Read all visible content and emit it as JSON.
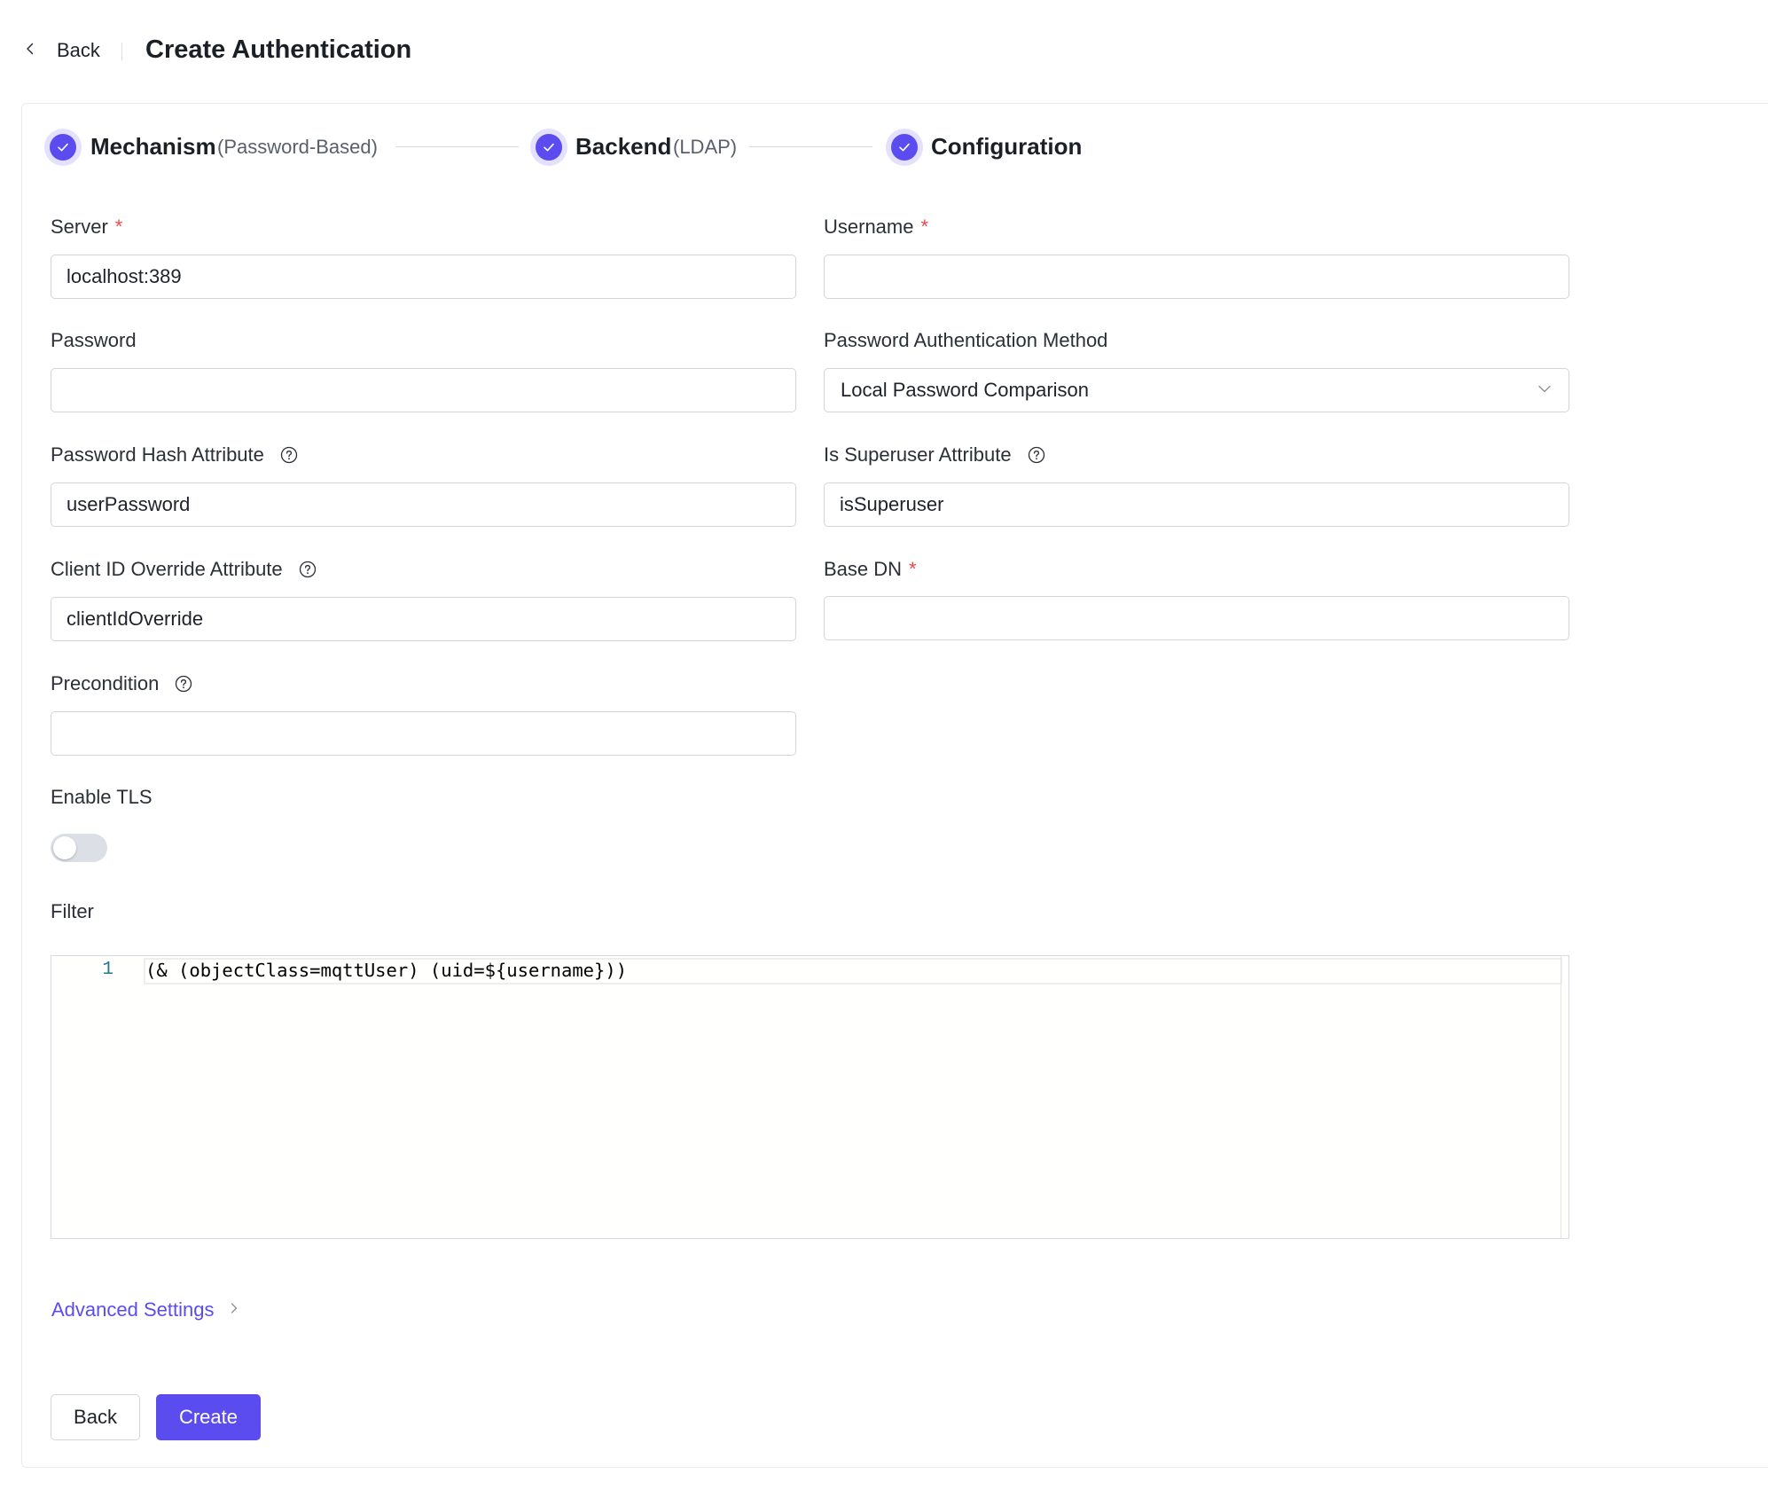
{
  "header": {
    "back_label": "Back",
    "title": "Create Authentication"
  },
  "steps": [
    {
      "title": "Mechanism",
      "subtitle": "(Password-Based)"
    },
    {
      "title": "Backend",
      "subtitle": "(LDAP)"
    },
    {
      "title": "Configuration",
      "subtitle": ""
    }
  ],
  "form": {
    "server": {
      "label": "Server",
      "required_mark": "*",
      "value": "localhost:389"
    },
    "username": {
      "label": "Username",
      "required_mark": "*",
      "value": ""
    },
    "password": {
      "label": "Password",
      "value": ""
    },
    "auth_method": {
      "label": "Password Authentication Method",
      "value": "Local Password Comparison"
    },
    "hash_attr": {
      "label": "Password Hash Attribute",
      "value": "userPassword"
    },
    "superuser_attr": {
      "label": "Is Superuser Attribute",
      "value": "isSuperuser"
    },
    "client_id_attr": {
      "label": "Client ID Override Attribute",
      "value": "clientIdOverride"
    },
    "base_dn": {
      "label": "Base DN",
      "required_mark": "*",
      "value": ""
    },
    "precondition": {
      "label": "Precondition",
      "value": ""
    },
    "enable_tls": {
      "label": "Enable TLS",
      "enabled": false
    },
    "filter": {
      "label": "Filter",
      "line_number": "1",
      "code": "(& (objectClass=mqttUser) (uid=${username}))"
    }
  },
  "advanced_label": "Advanced Settings",
  "footer": {
    "back_label": "Back",
    "create_label": "Create"
  },
  "colors": {
    "accent": "#5b4cf0",
    "required": "#e5484d"
  }
}
